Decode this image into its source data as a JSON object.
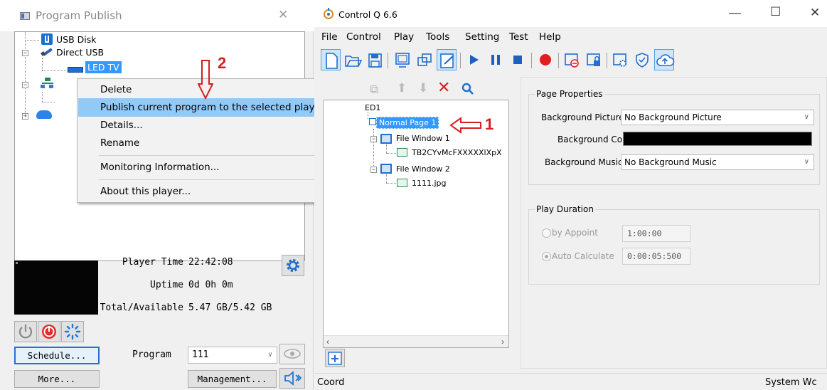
{
  "program_publish": {
    "title": "Program Publish",
    "tree": {
      "usb_disk": "USB Disk",
      "direct_usb": "Direct USB",
      "led_tv": "LED TV"
    },
    "context_menu": {
      "items": [
        "Delete",
        "Publish current program to the selected player",
        "Details...",
        "Rename",
        "Monitoring Information...",
        "About this player..."
      ],
      "highlighted_index": 1
    },
    "annotations": {
      "step2": "2",
      "step1": "1"
    },
    "info": {
      "player_time_label": "Player Time",
      "player_time_value": "22:42:08",
      "uptime_label": "Uptime",
      "uptime_value": "0d 0h 0m",
      "total_available_label": "Total/Available",
      "total_available_value": "5.47 GB/5.42 GB"
    },
    "schedule_button": "Schedule...",
    "more_button": "More...",
    "program_label": "Program",
    "program_value": "111",
    "management_button": "Management..."
  },
  "control_q": {
    "title": "Control Q 6.6",
    "menu": [
      "File",
      "Control",
      "Play",
      "Tools",
      "Setting",
      "Test",
      "Help"
    ],
    "program_tree": {
      "root_fragment": "ED1",
      "page": "Normal Page 1",
      "window1": "File Window 1",
      "file1": "TB2CYvMcFXXXXXlXpX",
      "window2": "File Window 2",
      "file2": "1111.jpg"
    },
    "page_properties": {
      "group_title": "Page Properties",
      "bg_picture_label": "Background Picture",
      "bg_picture_value": "No Background Picture",
      "bg_color_label": "Background Color",
      "bg_color_value": "#000000",
      "bg_music_label": "Background Music",
      "bg_music_value": "No Background Music"
    },
    "play_duration": {
      "group_title": "Play Duration",
      "by_appoint_label": "by Appoint",
      "by_appoint_value": "1:00:00",
      "auto_calc_label": "Auto Calculate",
      "auto_calc_value": "0:00:05:500"
    },
    "status": {
      "left": "Coord",
      "right": "System Wc"
    }
  },
  "colors": {
    "annotation_red": "#d61f1f",
    "play_blue": "#1e5fc0",
    "record_red": "#e11f1f",
    "selection_blue": "#3399ff"
  }
}
